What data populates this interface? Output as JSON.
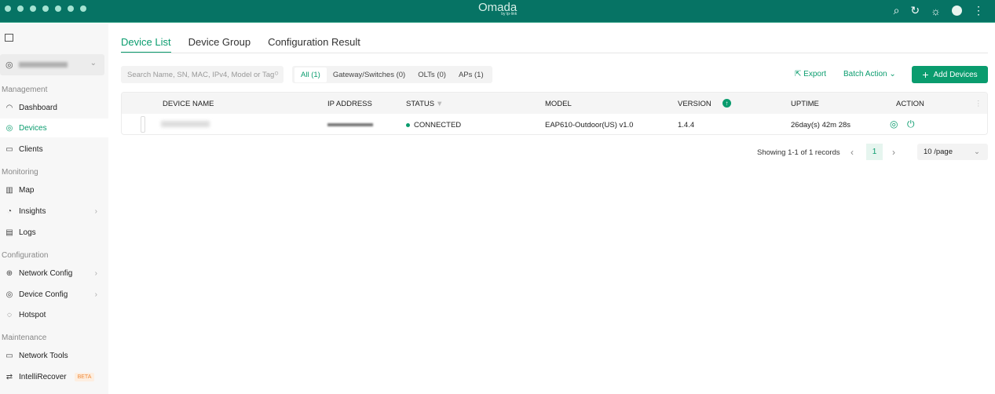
{
  "header": {
    "logo": "Omada",
    "logo_sub": "by tp-link"
  },
  "sidebar": {
    "sections": [
      "Management",
      "Monitoring",
      "Configuration",
      "Maintenance"
    ],
    "items": [
      {
        "label": "Dashboard",
        "icon": "dashboard-icon"
      },
      {
        "label": "Devices",
        "icon": "devices-icon"
      },
      {
        "label": "Clients",
        "icon": "clients-icon"
      },
      {
        "label": "Map",
        "icon": "map-icon"
      },
      {
        "label": "Insights",
        "icon": "insights-icon"
      },
      {
        "label": "Logs",
        "icon": "logs-icon"
      },
      {
        "label": "Network Config",
        "icon": "globe-icon"
      },
      {
        "label": "Device Config",
        "icon": "device-config-icon"
      },
      {
        "label": "Hotspot",
        "icon": "hotspot-icon"
      },
      {
        "label": "Network Tools",
        "icon": "toolbox-icon"
      },
      {
        "label": "IntelliRecover",
        "icon": "recover-icon",
        "badge": "BETA"
      }
    ]
  },
  "tabs": [
    "Device List",
    "Device Group",
    "Configuration Result"
  ],
  "search": {
    "placeholder": "Search Name, SN, MAC, IPv4, Model or Tag"
  },
  "filters": [
    "All (1)",
    "Gateway/Switches (0)",
    "OLTs (0)",
    "APs (1)"
  ],
  "toolbar": {
    "export": "Export",
    "batch": "Batch Action",
    "add": "Add Devices"
  },
  "table": {
    "headers": [
      "DEVICE NAME",
      "IP ADDRESS",
      "STATUS",
      "MODEL",
      "VERSION",
      "UPTIME",
      "ACTION"
    ],
    "rows": [
      {
        "status": "CONNECTED",
        "model": "EAP610-Outdoor(US) v1.0",
        "version": "1.4.4",
        "uptime": "26day(s) 42m 28s"
      }
    ]
  },
  "pagination": {
    "summary": "Showing 1-1 of 1 records",
    "page": "1",
    "per_page": "10 /page"
  },
  "colors": {
    "primary": "#0a9c6e",
    "topbar": "#067364"
  }
}
